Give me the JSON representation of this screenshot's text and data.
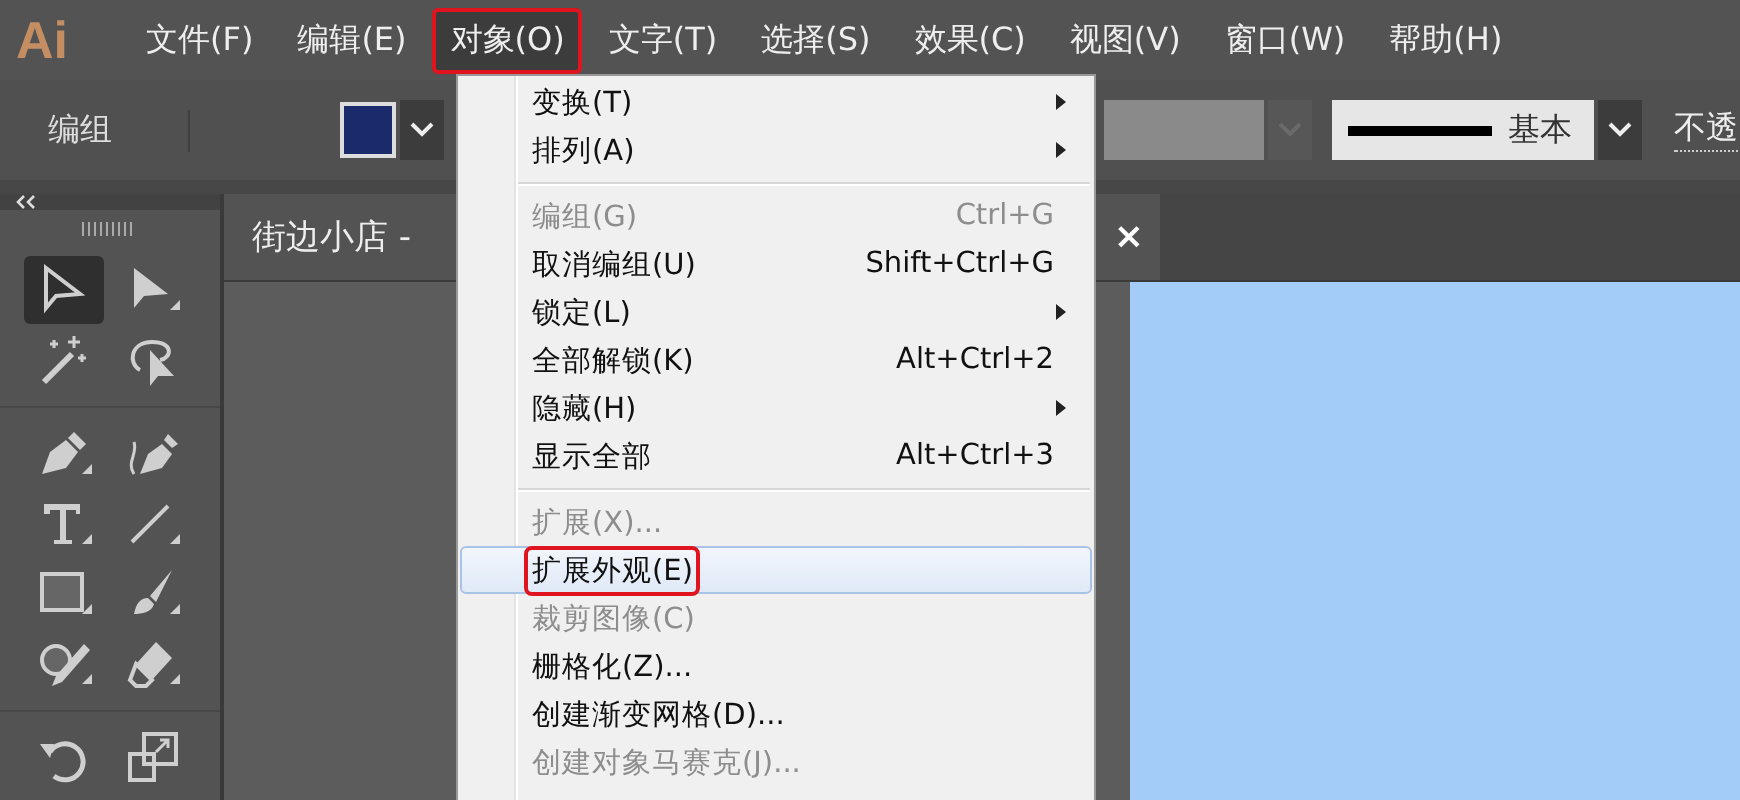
{
  "app": {
    "logo": "Ai"
  },
  "menubar": [
    {
      "label": "文件(F)",
      "selected": false,
      "outlined": false
    },
    {
      "label": "编辑(E)",
      "selected": false,
      "outlined": false
    },
    {
      "label": "对象(O)",
      "selected": true,
      "outlined": true
    },
    {
      "label": "文字(T)",
      "selected": false,
      "outlined": false
    },
    {
      "label": "选择(S)",
      "selected": false,
      "outlined": false
    },
    {
      "label": "效果(C)",
      "selected": false,
      "outlined": false
    },
    {
      "label": "视图(V)",
      "selected": false,
      "outlined": false
    },
    {
      "label": "窗口(W)",
      "selected": false,
      "outlined": false
    },
    {
      "label": "帮助(H)",
      "selected": false,
      "outlined": false
    }
  ],
  "control_bar": {
    "label": "编组",
    "stroke_profile": "基本",
    "opacity_label": "不透"
  },
  "tools": [
    [
      {
        "kind": "selection",
        "selected": true
      },
      {
        "kind": "direct-selection",
        "selected": false
      },
      {
        "kind": "magic-wand",
        "selected": false
      },
      {
        "kind": "lasso",
        "selected": false
      }
    ],
    [
      {
        "kind": "pen",
        "selected": false
      },
      {
        "kind": "curvature",
        "selected": false
      },
      {
        "kind": "type",
        "selected": false
      },
      {
        "kind": "line",
        "selected": false
      },
      {
        "kind": "rectangle",
        "selected": false
      },
      {
        "kind": "paintbrush",
        "selected": false
      },
      {
        "kind": "shaper",
        "selected": false
      },
      {
        "kind": "eraser",
        "selected": false
      }
    ],
    [
      {
        "kind": "rotate",
        "selected": false
      },
      {
        "kind": "scale",
        "selected": false
      }
    ]
  ],
  "document_tab": {
    "title": "街边小店 -",
    "close": "×"
  },
  "menu": [
    {
      "kind": "item",
      "label": "变换(T)",
      "submenu": true,
      "disabled": false,
      "highlighted": false,
      "outlined": false
    },
    {
      "kind": "item",
      "label": "排列(A)",
      "submenu": true,
      "disabled": false,
      "highlighted": false,
      "outlined": false
    },
    {
      "kind": "separator"
    },
    {
      "kind": "item",
      "label": "编组(G)",
      "shortcut": "Ctrl+G",
      "submenu": false,
      "disabled": true,
      "highlighted": false,
      "outlined": false
    },
    {
      "kind": "item",
      "label": "取消编组(U)",
      "shortcut": "Shift+Ctrl+G",
      "submenu": false,
      "disabled": false,
      "highlighted": false,
      "outlined": false
    },
    {
      "kind": "item",
      "label": "锁定(L)",
      "submenu": true,
      "disabled": false,
      "highlighted": false,
      "outlined": false
    },
    {
      "kind": "item",
      "label": "全部解锁(K)",
      "shortcut": "Alt+Ctrl+2",
      "submenu": false,
      "disabled": false,
      "highlighted": false,
      "outlined": false
    },
    {
      "kind": "item",
      "label": "隐藏(H)",
      "submenu": true,
      "disabled": false,
      "highlighted": false,
      "outlined": false
    },
    {
      "kind": "item",
      "label": "显示全部",
      "shortcut": "Alt+Ctrl+3",
      "submenu": false,
      "disabled": false,
      "highlighted": false,
      "outlined": false
    },
    {
      "kind": "separator"
    },
    {
      "kind": "item",
      "label": "扩展(X)...",
      "submenu": false,
      "disabled": true,
      "highlighted": false,
      "outlined": false
    },
    {
      "kind": "item",
      "label": "扩展外观(E)",
      "submenu": false,
      "disabled": false,
      "highlighted": true,
      "outlined": true
    },
    {
      "kind": "item",
      "label": "裁剪图像(C)",
      "submenu": false,
      "disabled": true,
      "highlighted": false,
      "outlined": false
    },
    {
      "kind": "item",
      "label": "栅格化(Z)...",
      "submenu": false,
      "disabled": false,
      "highlighted": false,
      "outlined": false
    },
    {
      "kind": "item",
      "label": "创建渐变网格(D)...",
      "submenu": false,
      "disabled": false,
      "highlighted": false,
      "outlined": false
    },
    {
      "kind": "item",
      "label": "创建对象马赛克(J)...",
      "submenu": false,
      "disabled": true,
      "highlighted": false,
      "outlined": false
    }
  ]
}
